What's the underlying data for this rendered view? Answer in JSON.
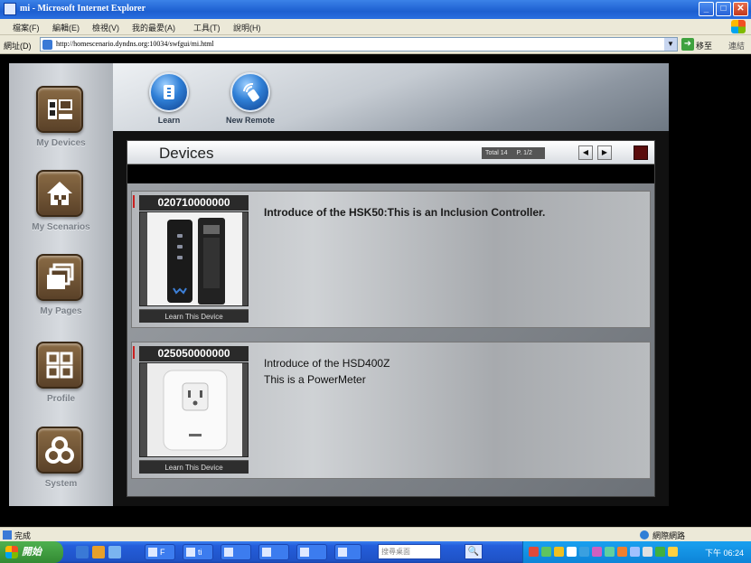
{
  "window": {
    "title": "mi - Microsoft Internet Explorer",
    "minimize": "_",
    "maximize": "□",
    "close": "✕"
  },
  "menubar": [
    "檔案(F)",
    "編輯(E)",
    "檢視(V)",
    "我的最愛(A)",
    "工具(T)",
    "說明(H)"
  ],
  "address": {
    "label": "網址(D)",
    "url": "http://homescenario.dyndns.org:10034/swfgui/mi.html",
    "go_label": "移至",
    "links_label": "連結"
  },
  "sidebar": {
    "items": [
      {
        "label": "My Devices",
        "icon": "devices-icon"
      },
      {
        "label": "My Scenarios",
        "icon": "house-icon"
      },
      {
        "label": "My Pages",
        "icon": "pages-icon"
      },
      {
        "label": "Profile",
        "icon": "profile-grid-icon"
      },
      {
        "label": "System",
        "icon": "system-icon"
      }
    ]
  },
  "toolbar": {
    "learn_label": "Learn",
    "new_remote_label": "New Remote"
  },
  "panel": {
    "title": "Devices",
    "pager_total": "Total 14",
    "pager_page": "P. 1/2",
    "prev": "◀",
    "next": "▶"
  },
  "devices": [
    {
      "id": "020710000000",
      "learn_label": "Learn This Device",
      "description": [
        "Introduce of the HSK50:This is an Inclusion Controller."
      ],
      "image": "remote-controller-image"
    },
    {
      "id": "025050000000",
      "learn_label": "Learn This Device",
      "description": [
        "Introduce of the HSD400Z",
        "This is a PowerMeter"
      ],
      "image": "power-meter-plug-image"
    }
  ],
  "statusbar": {
    "left": "完成",
    "right": "網際網路"
  },
  "taskbar": {
    "start_label": "開始",
    "tasks": [
      "F",
      "ti",
      "",
      "",
      "",
      ""
    ],
    "search_placeholder": "搜尋桌面",
    "search_icon": "🔍",
    "clock": "下午 06:24"
  },
  "colors": {
    "titlebar": "#1d5fd0",
    "sidebar_icon": "#6b4f33",
    "orb": "#2f7fd6",
    "stop_button": "#5a0c0c"
  }
}
